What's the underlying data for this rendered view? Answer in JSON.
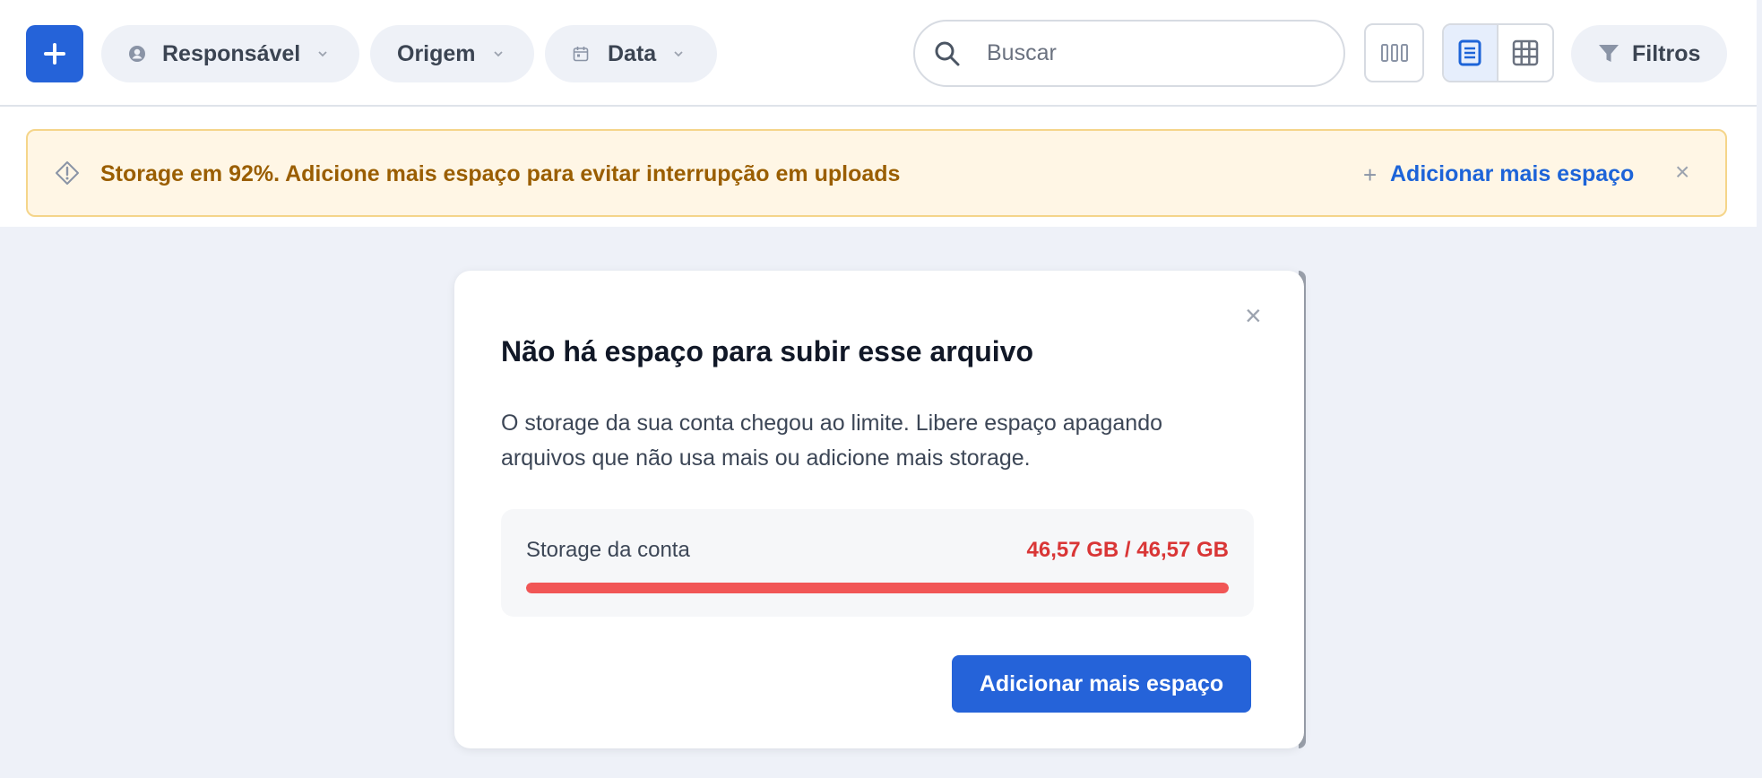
{
  "toolbar": {
    "add_label": "+",
    "filters": {
      "responsavel": "Responsável",
      "origem": "Origem",
      "data": "Data"
    },
    "search": {
      "placeholder": "Buscar",
      "value": ""
    },
    "view_mode": "list",
    "filters_button": "Filtros"
  },
  "banner": {
    "message": "Storage em 92%. Adicione mais espaço para evitar interrupção em uploads",
    "action_plus": "+",
    "action_label": "Adicionar mais espaço",
    "close": "×",
    "colors": {
      "background": "#fff6e5",
      "text": "#9a5e00",
      "link": "#1d64d8"
    }
  },
  "modal": {
    "close": "×",
    "title": "Não há espaço para subir esse arquivo",
    "body": "O storage da sua conta chegou ao limite. Libere espaço apagando arquivos que não usa mais ou adicione mais storage.",
    "storage": {
      "label": "Storage da conta",
      "value": "46,57 GB / 46,57 GB",
      "used_fraction": 1.0
    },
    "cta": "Adicionar mais espaço"
  },
  "colors": {
    "primary": "#2563d9",
    "danger": "#d93636",
    "bar": "#f15656"
  },
  "icons": [
    "plus-icon",
    "user-icon",
    "chevron-down-icon",
    "calendar-icon",
    "search-icon",
    "columns-icon",
    "list-icon",
    "grid-icon",
    "filter-icon",
    "warning-icon",
    "close-icon"
  ]
}
